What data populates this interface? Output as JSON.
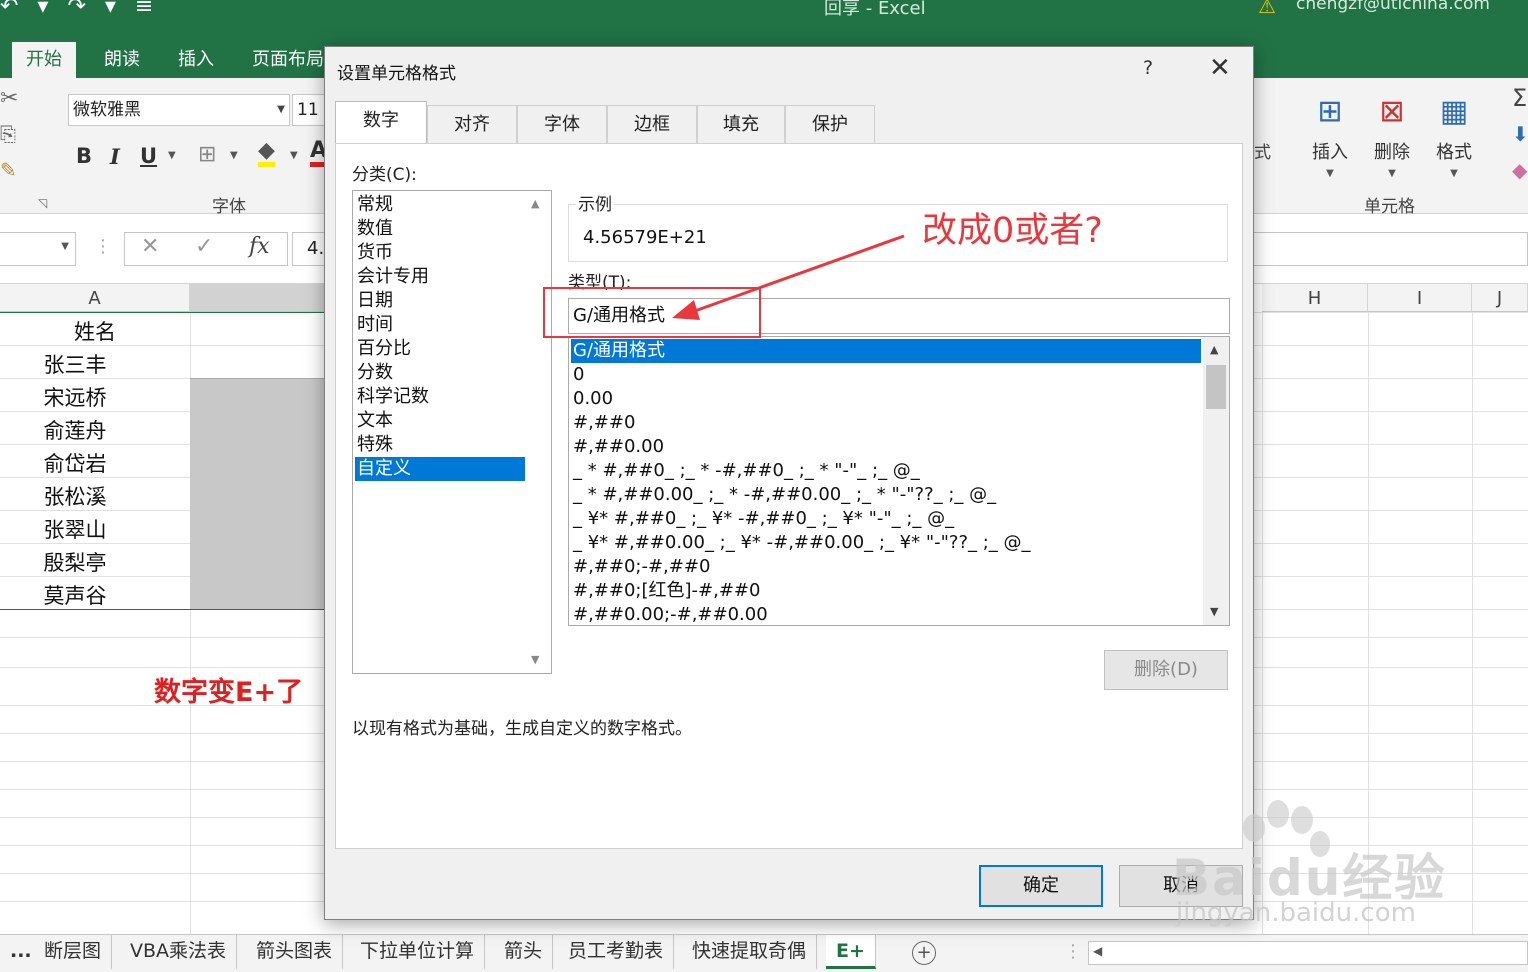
{
  "titlebar": {
    "quick_access": "↶ ▾ ↷ ▾ ≡",
    "title": "回享  -  Excel",
    "user": "chengzf@utichina.com"
  },
  "ribbon_tabs": [
    "开始",
    "朗读",
    "插入",
    "页面布局"
  ],
  "font_group": {
    "font_name": "微软雅黑",
    "font_size": "11",
    "bold": "B",
    "italic": "I",
    "underline": "U",
    "label": "字体"
  },
  "cells_group": {
    "insert": "插入",
    "delete": "删除",
    "format": "格式",
    "label": "单元格",
    "partial": "式"
  },
  "formula_bar": {
    "fx": "fx",
    "value": "4."
  },
  "columns": [
    "A",
    "H",
    "I",
    "J"
  ],
  "sheet": {
    "header": "姓名",
    "names": [
      "张三丰",
      "宋远桥",
      "俞莲舟",
      "俞岱岩",
      "张松溪",
      "张翠山",
      "殷梨亭",
      "莫声谷"
    ],
    "note": "数字变E+了"
  },
  "sheet_tabs": [
    "...",
    "断层图",
    "VBA乘法表",
    "箭头图表",
    "下拉单位计算",
    "箭头",
    "员工考勤表",
    "快速提取奇偶",
    "E+"
  ],
  "dialog": {
    "title": "设置单元格格式",
    "help": "?",
    "tabs": [
      "数字",
      "对齐",
      "字体",
      "边框",
      "填充",
      "保护"
    ],
    "category_label": "分类(C):",
    "categories": [
      "常规",
      "数值",
      "货币",
      "会计专用",
      "日期",
      "时间",
      "百分比",
      "分数",
      "科学记数",
      "文本",
      "特殊",
      "自定义"
    ],
    "selected_category": "自定义",
    "sample_label": "示例",
    "sample_value": "4.56579E+21",
    "type_label": "类型(T):",
    "type_value": "G/通用格式",
    "formats": [
      "G/通用格式",
      "0",
      "0.00",
      "#,##0",
      "#,##0.00",
      "_ * #,##0_ ;_ * -#,##0_ ;_ * \"-\"_ ;_ @_",
      "_ * #,##0.00_ ;_ * -#,##0.00_ ;_ * \"-\"??_ ;_ @_",
      "_ ¥* #,##0_ ;_ ¥* -#,##0_ ;_ ¥* \"-\"_ ;_ @_",
      "_ ¥* #,##0.00_ ;_ ¥* -#,##0.00_ ;_ ¥* \"-\"??_ ;_ @_",
      "#,##0;-#,##0",
      "#,##0;[红色]-#,##0",
      "#,##0.00;-#,##0.00"
    ],
    "delete_button": "删除(D)",
    "description": "以现有格式为基础，生成自定义的数字格式。",
    "ok": "确定",
    "cancel": "取消"
  },
  "annotation": {
    "text": "改成0或者?",
    "color": "#e8383d"
  },
  "watermark": {
    "brand": "Baidu经验",
    "url": "jingyan.baidu.com"
  },
  "colors": {
    "excel_green": "#217346",
    "selection_blue": "#0078d7",
    "annotation_red": "#e8383d"
  }
}
